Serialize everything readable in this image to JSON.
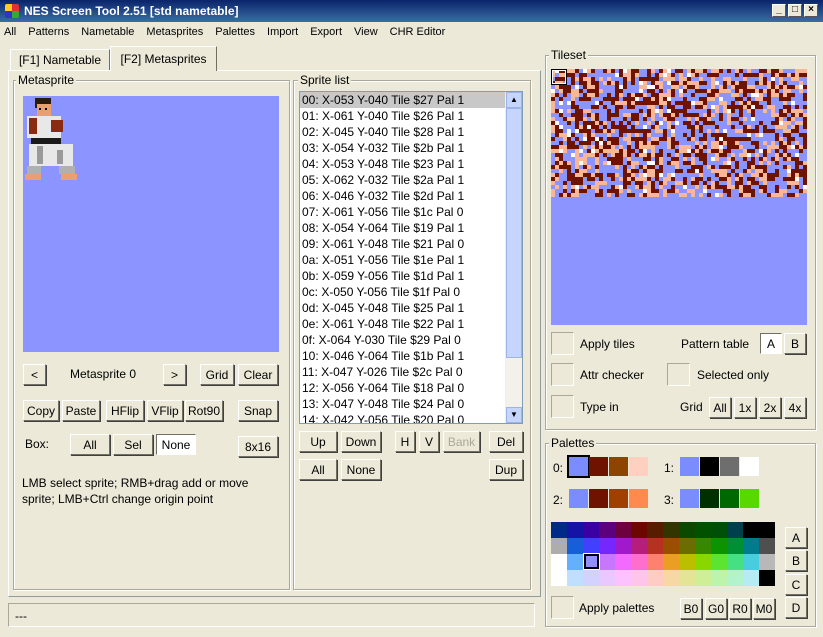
{
  "window": {
    "title": "NES Screen Tool 2.51  [std nametable]"
  },
  "menu": [
    "All",
    "Patterns",
    "Nametable",
    "Metasprites",
    "Palettes",
    "Import",
    "Export",
    "View",
    "CHR Editor"
  ],
  "tabs": {
    "nametable": "[F1] Nametable",
    "metasprites": "[F2] Metasprites"
  },
  "metasprite": {
    "group_title": "Metasprite",
    "prev": "<",
    "name": "Metasprite 0",
    "next": ">",
    "grid": "Grid",
    "clear": "Clear",
    "copy": "Copy",
    "paste": "Paste",
    "hflip": "HFlip",
    "vflip": "VFlip",
    "rot90": "Rot90",
    "snap": "Snap",
    "box_label": "Box:",
    "box_all": "All",
    "box_sel": "Sel",
    "box_none": "None",
    "size": "8x16",
    "help": "LMB select sprite; RMB+drag add or move sprite; LMB+Ctrl change origin point"
  },
  "sprite_list": {
    "group_title": "Sprite list",
    "rows": [
      "00: X-053 Y-040 Tile $27 Pal 1",
      "01: X-061 Y-040 Tile $26 Pal 1",
      "02: X-045 Y-040 Tile $28 Pal 1",
      "03: X-054 Y-032 Tile $2b Pal 1",
      "04: X-053 Y-048 Tile $23 Pal 1",
      "05: X-062 Y-032 Tile $2a Pal 1",
      "06: X-046 Y-032 Tile $2d Pal 1",
      "07: X-061 Y-056 Tile $1c Pal 0",
      "08: X-054 Y-064 Tile $19 Pal 1",
      "09: X-061 Y-048 Tile $21 Pal 0",
      "0a: X-051 Y-056 Tile $1e Pal 1",
      "0b: X-059 Y-056 Tile $1d Pal 1",
      "0c: X-050 Y-056 Tile $1f Pal 0",
      "0d: X-045 Y-048 Tile $25 Pal 1",
      "0e: X-061 Y-048 Tile $22 Pal 1",
      "0f: X-064 Y-030 Tile $29 Pal 0",
      "10: X-046 Y-064 Tile $1b Pal 1",
      "11: X-047 Y-026 Tile $2c Pal 0",
      "12: X-056 Y-064 Tile $18 Pal 0",
      "13: X-047 Y-048 Tile $24 Pal 0",
      "14: X-042 Y-056 Tile $20 Pal 0"
    ],
    "up": "Up",
    "down": "Down",
    "h": "H",
    "v": "V",
    "bank": "Bank",
    "del": "Del",
    "all": "All",
    "none": "None",
    "dup": "Dup"
  },
  "tileset": {
    "group_title": "Tileset",
    "apply_tiles": "Apply tiles",
    "pattern_table": "Pattern table",
    "pt_a": "A",
    "pt_b": "B",
    "attr_checker": "Attr checker",
    "selected_only": "Selected only",
    "type_in": "Type in",
    "grid": "Grid",
    "grid_all": "All",
    "grid_1x": "1x",
    "grid_2x": "2x",
    "grid_4x": "4x"
  },
  "palettes": {
    "group_title": "Palettes",
    "labels": [
      "0:",
      "1:",
      "2:",
      "3:"
    ],
    "sets": [
      [
        "#7b8cff",
        "#6e1300",
        "#8b4500",
        "#ffd0c0"
      ],
      [
        "#7b8cff",
        "#000000",
        "#6e6e6e",
        "#ffffff"
      ],
      [
        "#7b8cff",
        "#6e1300",
        "#a04000",
        "#ff8a50"
      ],
      [
        "#7b8cff",
        "#003000",
        "#006800",
        "#58d800"
      ]
    ],
    "side": [
      "A",
      "B",
      "C",
      "D"
    ],
    "apply_palettes": "Apply palettes",
    "b0": "B0",
    "g0": "G0",
    "r0": "R0",
    "m0": "M0",
    "master": [
      [
        "#002a88",
        "#1412a7",
        "#3b00a4",
        "#5c007e",
        "#6e0040",
        "#6c0600",
        "#561d00",
        "#333500",
        "#0b4800",
        "#005200",
        "#004f08",
        "#00404d",
        "#000000"
      ],
      [
        "#adadad",
        "#155fd9",
        "#4240ff",
        "#7527fe",
        "#a01acc",
        "#b71e7b",
        "#b53120",
        "#994e00",
        "#6b6d00",
        "#388700",
        "#0c9300",
        "#008f32",
        "#007c8d"
      ],
      [
        "#ffffff",
        "#64b0ff",
        "#9290ff",
        "#c676ff",
        "#f36aff",
        "#fe6ecc",
        "#fe8170",
        "#ea9e22",
        "#bcbe00",
        "#88d800",
        "#5ce430",
        "#45e082",
        "#48cdde"
      ],
      [
        "#ffffff",
        "#c0dfff",
        "#d3d2ff",
        "#e8c8ff",
        "#fbc2ff",
        "#fec4ea",
        "#fecbc5",
        "#f7d8a5",
        "#e4e594",
        "#cfef96",
        "#bdf4ab",
        "#b3f3cc",
        "#b5ebf2"
      ]
    ],
    "master_right": [
      "#000000",
      "#4f4f4f",
      "#b8b8b8"
    ]
  },
  "status": {
    "text": "---"
  }
}
